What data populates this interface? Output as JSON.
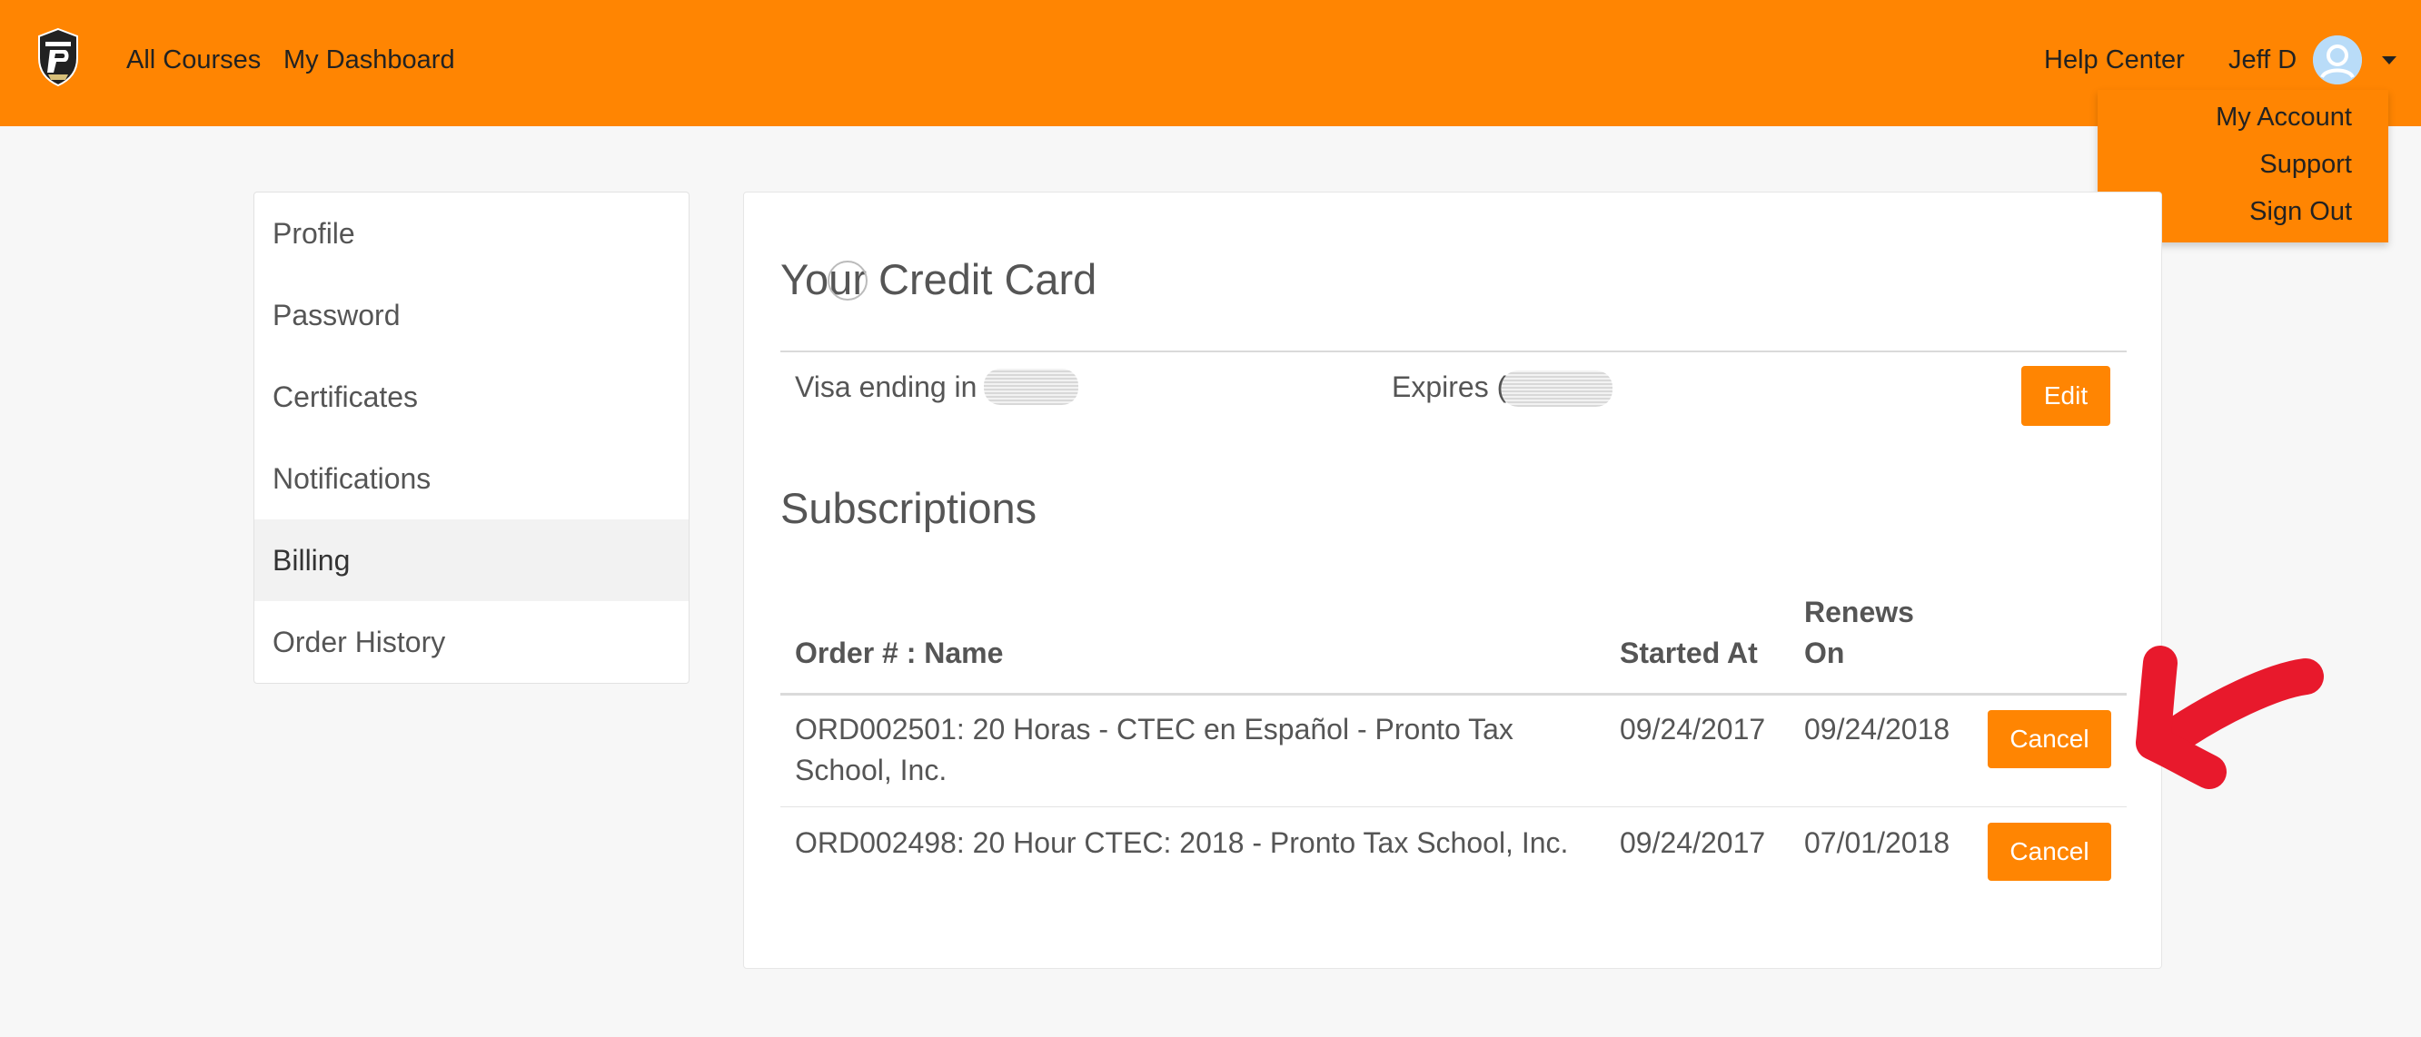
{
  "header": {
    "nav": {
      "all_courses": "All Courses",
      "my_dashboard": "My Dashboard",
      "help_center": "Help Center"
    },
    "user": {
      "name": "Jeff D",
      "avatar_icon": "user-avatar-icon",
      "caret_icon": "caret-down-icon"
    },
    "dropdown": [
      "My Account",
      "Support",
      "Sign Out"
    ],
    "brand_color": "#ff8502"
  },
  "sidebar": {
    "items": [
      {
        "label": "Profile",
        "active": false
      },
      {
        "label": "Password",
        "active": false
      },
      {
        "label": "Certificates",
        "active": false
      },
      {
        "label": "Notifications",
        "active": false
      },
      {
        "label": "Billing",
        "active": true
      },
      {
        "label": "Order History",
        "active": false
      }
    ]
  },
  "credit_card": {
    "title": "Your Credit Card",
    "card_label": "Visa ending in",
    "expires_label": "Expires (",
    "edit_button": "Edit"
  },
  "subscriptions": {
    "title": "Subscriptions",
    "columns": {
      "order_name": "Order # : Name",
      "started_at": "Started At",
      "renews_line1": "Renews",
      "renews_line2": "On"
    },
    "rows": [
      {
        "name_line1": "ORD002501: 20 Horas - CTEC en Español - Pronto Tax",
        "name_line2": "School, Inc.",
        "started": "09/24/2017",
        "renews": "09/24/2018",
        "action": "Cancel"
      },
      {
        "name_line1": "ORD002498: 20 Hour CTEC: 2018 - Pronto Tax School, Inc.",
        "name_line2": "",
        "started": "09/24/2017",
        "renews": "07/01/2018",
        "action": "Cancel"
      }
    ]
  },
  "annotation": {
    "arrow_color": "#e8192c"
  }
}
